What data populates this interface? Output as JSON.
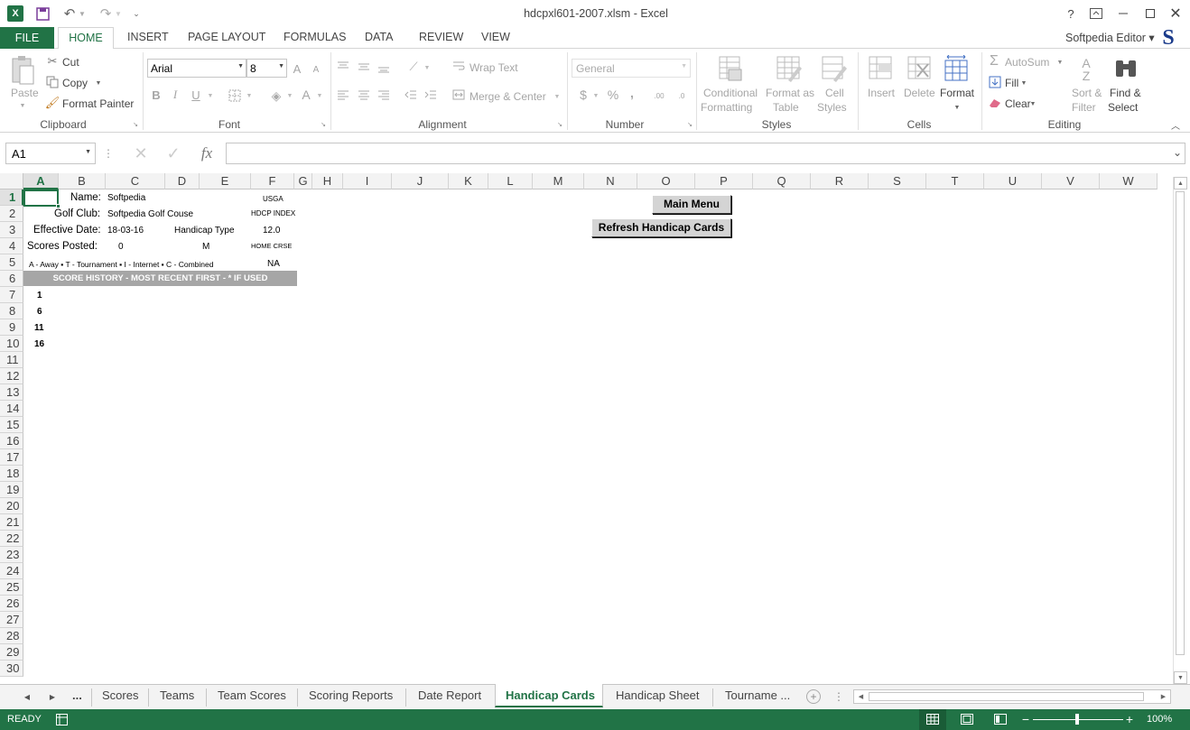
{
  "window": {
    "title": "hdcpxl601-2007.xlsm - Excel",
    "help": "?",
    "user": "Softpedia Editor"
  },
  "ribbon_tabs": [
    "FILE",
    "HOME",
    "INSERT",
    "PAGE LAYOUT",
    "FORMULAS",
    "DATA",
    "REVIEW",
    "VIEW"
  ],
  "clipboard": {
    "paste": "Paste",
    "cut": "Cut",
    "copy": "Copy",
    "format_painter": "Format Painter",
    "group": "Clipboard"
  },
  "font": {
    "name": "Arial",
    "size": "8",
    "group": "Font",
    "bold": "B",
    "italic": "I",
    "underline": "U",
    "grow": "A",
    "shrink": "A",
    "color": "A"
  },
  "alignment": {
    "wrap": "Wrap Text",
    "merge": "Merge & Center",
    "group": "Alignment"
  },
  "number": {
    "format": "General",
    "currency": "$",
    "percent": "%",
    "comma": ",",
    "inc": ".00",
    "dec": ".0",
    "group": "Number"
  },
  "styles": {
    "cond1": "Conditional",
    "cond2": "Formatting",
    "fmt1": "Format as",
    "fmt2": "Table",
    "cell1": "Cell",
    "cell2": "Styles",
    "group": "Styles"
  },
  "cells": {
    "insert": "Insert",
    "delete": "Delete",
    "format": "Format",
    "group": "Cells"
  },
  "editing": {
    "autosum": "AutoSum",
    "fill": "Fill",
    "clear": "Clear",
    "sort1": "Sort &",
    "sort2": "Filter",
    "find1": "Find &",
    "find2": "Select",
    "group": "Editing"
  },
  "formula_bar": {
    "name_box": "A1",
    "fx": "fx",
    "formula": ""
  },
  "columns": [
    "A",
    "B",
    "C",
    "D",
    "E",
    "F",
    "G",
    "H",
    "I",
    "J",
    "K",
    "L",
    "M",
    "N",
    "O",
    "P",
    "Q",
    "R",
    "S",
    "T",
    "U",
    "V",
    "W"
  ],
  "rows": [
    "1",
    "2",
    "3",
    "4",
    "5",
    "6",
    "7",
    "8",
    "9",
    "10",
    "11",
    "12",
    "13",
    "14",
    "15",
    "16",
    "17",
    "18",
    "19",
    "20",
    "21",
    "22",
    "23",
    "24",
    "25",
    "26",
    "27",
    "28",
    "29",
    "30"
  ],
  "sheet": {
    "name_label": "Name:",
    "name_value": "Softpedia",
    "usga": "USGA",
    "club_label": "Golf Club:",
    "club_value": "Softpedia Golf Couse",
    "hdcp_index": "HDCP  INDEX",
    "date_label": "Effective Date:",
    "date_value": "18-03-16",
    "htype_label": "Handicap Type",
    "index_value": "12.0",
    "posted_label": "Scores Posted:",
    "posted_value": "0",
    "htype_value": "M",
    "home_crse": "HOME CRSE",
    "legend": "A - Away  ▪  T - Tournament  ▪  I - Internet  ▪  C - Combined",
    "legend_value": "NA",
    "history_header": "SCORE HISTORY - MOST RECENT FIRST - * IF USED",
    "score_rows": [
      "1",
      "6",
      "11",
      "16"
    ],
    "main_menu": "Main Menu",
    "refresh": "Refresh Handicap Cards"
  },
  "sheet_tabs": {
    "ellipsis_left": "...",
    "tabs": [
      "Scores",
      "Teams",
      "Team Scores",
      "Scoring Reports",
      "Date Report",
      "Handicap Cards",
      "Handicap Sheet",
      "Tourname ..."
    ],
    "active": "Handicap Cards"
  },
  "status": {
    "ready": "READY",
    "zoom": "100%"
  },
  "colors": {
    "excel_green": "#217346",
    "active_tab": "#217346",
    "header_grey": "#a6a6a6"
  }
}
